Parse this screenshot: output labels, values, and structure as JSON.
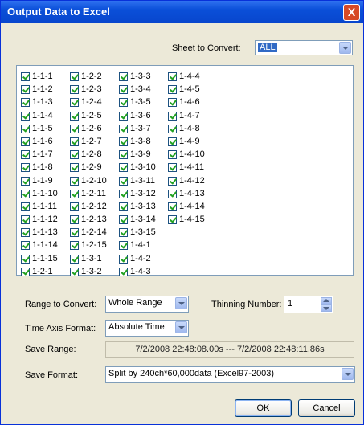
{
  "window": {
    "title": "Output Data to Excel",
    "close_label": "X"
  },
  "sheet": {
    "label": "Sheet to Convert:",
    "value": "ALL"
  },
  "checklist": {
    "columns": [
      [
        "1-1-1",
        "1-1-2",
        "1-1-3",
        "1-1-4",
        "1-1-5",
        "1-1-6",
        "1-1-7",
        "1-1-8",
        "1-1-9",
        "1-1-10",
        "1-1-11",
        "1-1-12",
        "1-1-13",
        "1-1-14",
        "1-1-15",
        "1-2-1"
      ],
      [
        "1-2-2",
        "1-2-3",
        "1-2-4",
        "1-2-5",
        "1-2-6",
        "1-2-7",
        "1-2-8",
        "1-2-9",
        "1-2-10",
        "1-2-11",
        "1-2-12",
        "1-2-13",
        "1-2-14",
        "1-2-15",
        "1-3-1",
        "1-3-2"
      ],
      [
        "1-3-3",
        "1-3-4",
        "1-3-5",
        "1-3-6",
        "1-3-7",
        "1-3-8",
        "1-3-9",
        "1-3-10",
        "1-3-11",
        "1-3-12",
        "1-3-13",
        "1-3-14",
        "1-3-15",
        "1-4-1",
        "1-4-2",
        "1-4-3"
      ],
      [
        "1-4-4",
        "1-4-5",
        "1-4-6",
        "1-4-7",
        "1-4-8",
        "1-4-9",
        "1-4-10",
        "1-4-11",
        "1-4-12",
        "1-4-13",
        "1-4-14",
        "1-4-15"
      ]
    ],
    "all_checked": true
  },
  "range": {
    "label": "Range to Convert:",
    "value": "Whole Range"
  },
  "thinning": {
    "label": "Thinning Number:",
    "value": "1"
  },
  "time_axis": {
    "label": "Time Axis Format:",
    "value": "Absolute Time"
  },
  "save_range": {
    "label": "Save Range:",
    "value": "7/2/2008 22:48:08.00s  ---  7/2/2008 22:48:11.86s"
  },
  "save_format": {
    "label": "Save Format:",
    "value": "Split by 240ch*60,000data (Excel97-2003)"
  },
  "buttons": {
    "ok": "OK",
    "cancel": "Cancel"
  }
}
